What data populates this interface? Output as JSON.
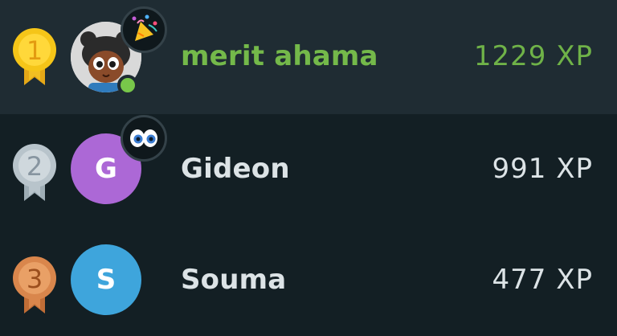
{
  "colors": {
    "background": "#131f24",
    "highlight_row": "#1f2c33",
    "current_user_green": "#74b94a",
    "gold": "#f5c518",
    "silver": "#b8c4cb",
    "bronze": "#d9864c",
    "online": "#78c74a"
  },
  "leaderboard": [
    {
      "rank": "1",
      "medal": "gold-medal-icon",
      "avatar_type": "character",
      "avatar_letter": "",
      "online": true,
      "badge": "party-popper-icon",
      "name": "merit ahama",
      "xp": "1229 XP",
      "is_current_user": true
    },
    {
      "rank": "2",
      "medal": "silver-medal-icon",
      "avatar_type": "letter",
      "avatar_letter": "G",
      "online": false,
      "badge": "eyes-icon",
      "name": "Gideon",
      "xp": "991 XP",
      "is_current_user": false
    },
    {
      "rank": "3",
      "medal": "bronze-medal-icon",
      "avatar_type": "letter",
      "avatar_letter": "S",
      "online": false,
      "badge": "",
      "name": "Souma",
      "xp": "477 XP",
      "is_current_user": false
    }
  ]
}
